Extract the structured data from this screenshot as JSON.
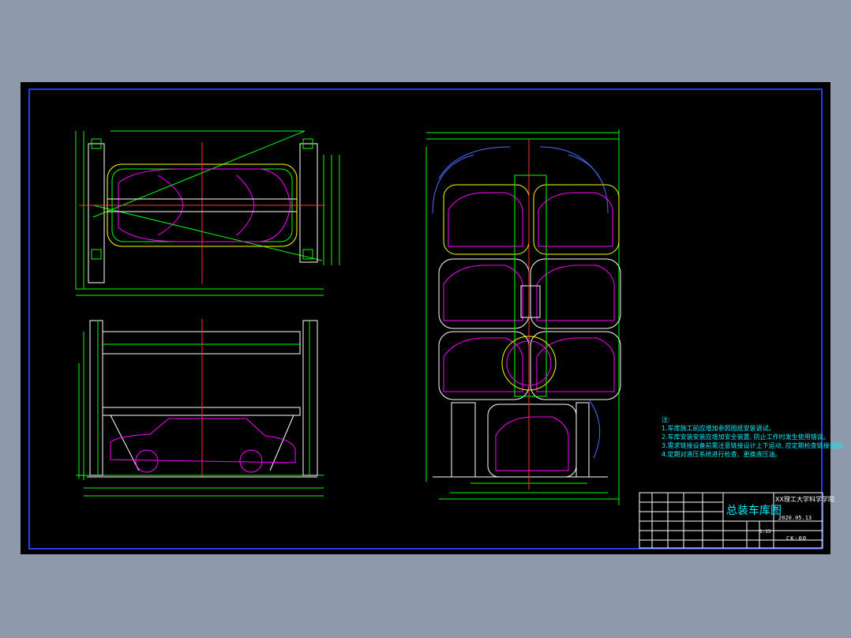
{
  "notes": {
    "heading": "注:",
    "items": [
      "1.车库施工前应增加参照图纸安装调试。",
      "2.车库安装安装应增加安全装置, 防止工作时发生使用错误。",
      "3.需求链接设备前需注意链接设计上下运动, 应定期检查链接设施。",
      "4.定期对液压系统进行检查、更换液压油。"
    ]
  },
  "title_block": {
    "title": "总装车库图",
    "school": "XX理工大学科学学院",
    "date": "2020.05.13",
    "scale": "1:15",
    "drawing_code": "CK-00"
  },
  "colors": {
    "frame": "#1f3cff",
    "dimension": "#00ff00",
    "structure": "#ffffff",
    "vehicle": "#ff00ff",
    "centerline": "#ff3030",
    "annotation": "#00f0ff",
    "hatch": "#ffff00"
  }
}
